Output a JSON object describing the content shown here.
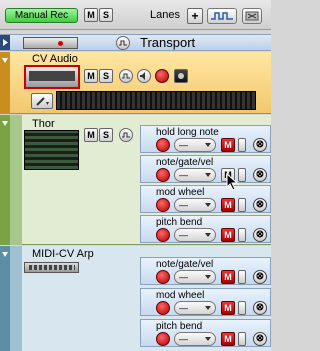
{
  "header": {
    "manual_rec": "Manual Rec",
    "m": "M",
    "s": "S",
    "lanes": "Lanes",
    "plus": "+"
  },
  "transport": {
    "title": "Transport"
  },
  "cv_audio": {
    "title": "CV Audio",
    "m": "M",
    "s": "S"
  },
  "thor": {
    "title": "Thor",
    "m": "M",
    "s": "S",
    "lanes": [
      {
        "label": "hold long note"
      },
      {
        "label": "note/gate/vel"
      },
      {
        "label": "mod wheel"
      },
      {
        "label": "pitch bend"
      }
    ]
  },
  "midi_cv_arp": {
    "title": "MIDI-CV Arp",
    "lanes": [
      {
        "label": "note/gate/vel"
      },
      {
        "label": "mod wheel"
      },
      {
        "label": "pitch bend"
      }
    ]
  },
  "lane_button": {
    "m": "M",
    "x": "⊗"
  }
}
